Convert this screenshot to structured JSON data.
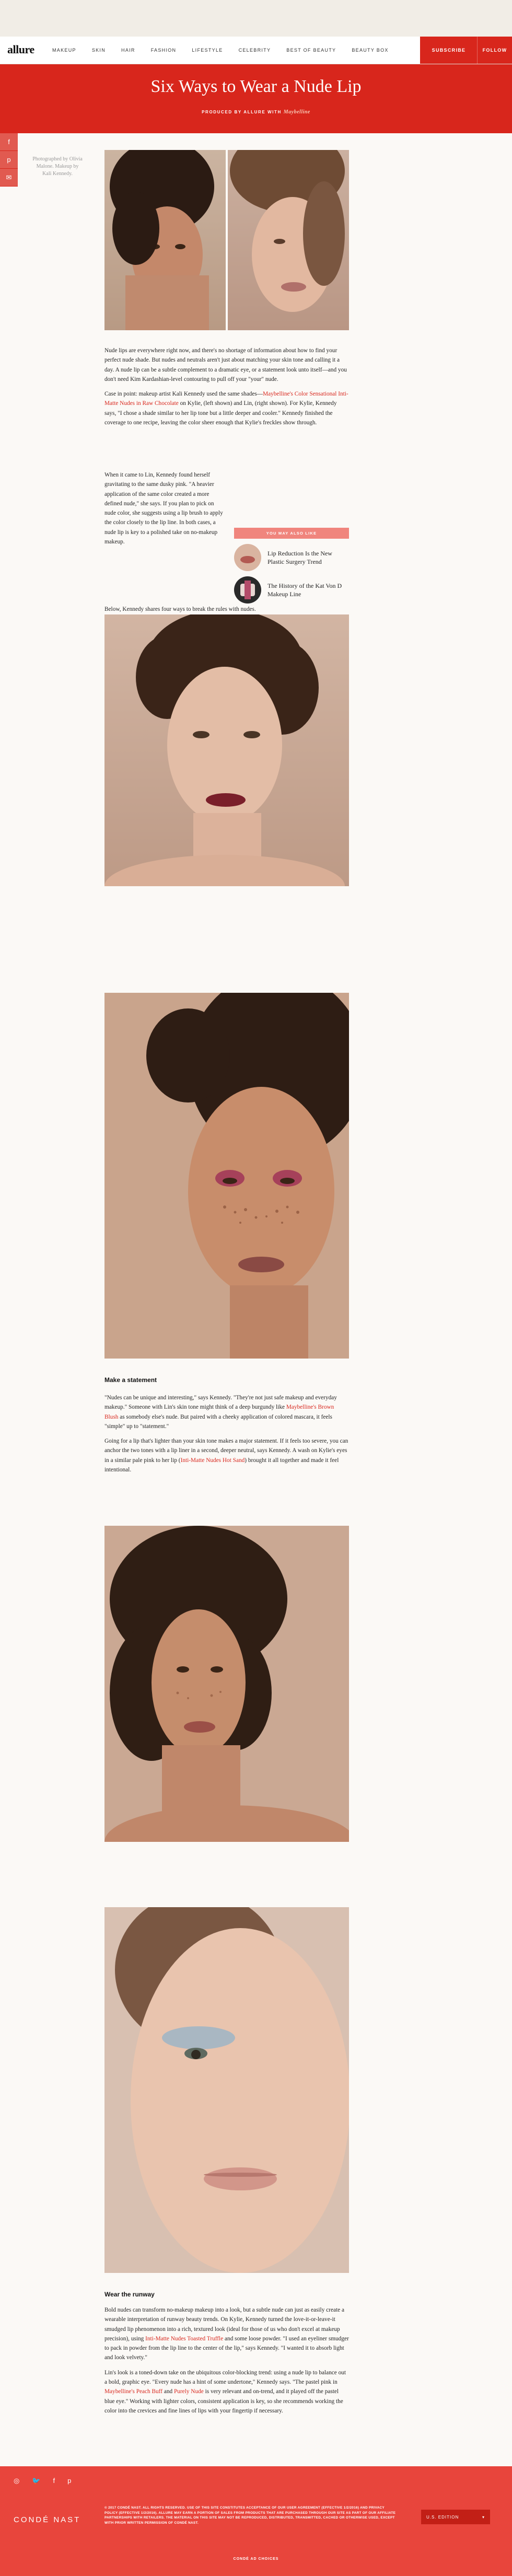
{
  "site": {
    "logo": "allure",
    "nav": [
      "MAKEUP",
      "SKIN",
      "HAIR",
      "FASHION",
      "LIFESTYLE",
      "CELEBRITY",
      "BEST OF BEAUTY",
      "BEAUTY BOX"
    ],
    "subscribe": "SUBSCRIBE",
    "follow": "FOLLOW"
  },
  "article": {
    "title": "Six Ways to Wear a Nude Lip",
    "credit_prefix": "PRODUCED BY ALLURE WITH",
    "credit_brand": "Maybelline",
    "photo_caption": "Photographed by Olivia Malone. Makeup by Kali Kennedy.",
    "share": [
      "f",
      "p",
      "✉"
    ],
    "intro_1": "Nude lips are everywhere right now, and there's no shortage of information about how to find your perfect nude shade. But nudes and neutrals aren't just about matching your skin tone and calling it a day. A nude lip can be a subtle complement to a dramatic eye, or a statement look unto itself—and you don't need Kim Kardashian-level contouring to pull off your \"your\" nude.",
    "intro_2_a": "Case in point: makeup artist Kali Kennedy used the same shades—",
    "intro_2_link": "Maybelline's Color Sensational Inti-Matte Nudes in Raw Chocolate",
    "intro_2_b": " on Kylie, (left shown) and Lin, (right shown). For Kylie, Kennedy says, \"I chose a shade similar to her lip tone but a little deeper and cooler.\" Kennedy finished the coverage to one recipe, leaving the color sheer enough that Kylie's freckles show through.",
    "intro_3": "When it came to Lin, Kennedy found herself gravitating to the same dusky pink. \"A heavier application of the same color created a more defined nude,\" she says. If you plan to pick on nude color, she suggests using a lip brush to apply the color closely to the lip line. In both cases, a nude lip is key to a polished take on no-makeup makeup.",
    "intro_4": "Below, Kennedy shares four ways to break the rules with nudes.",
    "read_also": {
      "header": "YOU MAY ALSO LIKE",
      "items": [
        "Lip Reduction Is the New Plastic Surgery Trend",
        "The History of the Kat Von D Makeup Line"
      ]
    },
    "section_1": {
      "title": "Make a statement",
      "p1_a": "\"Nudes can be unique and interesting,\" says Kennedy. \"They're not just safe makeup and everyday makeup.\" Someone with Lin's skin tone might think of a deep burgundy like ",
      "p1_link": "Maybelline's Brown Blush",
      "p1_b": " as somebody else's nude. But paired with a cheeky application of colored mascara, it feels \"simple\" up to \"statement.\"",
      "p2_a": "Going for a lip that's lighter than your skin tone makes a major statement. If it feels too severe, you can anchor the two tones with a lip liner in a second, deeper neutral, says Kennedy. A wash on Kylie's eyes in a similar pale pink to her lip (",
      "p2_link": "Inti-Matte Nudes Hot Sand",
      "p2_b": ") brought it all together and made it feel intentional."
    },
    "section_2": {
      "title": "Wear the runway",
      "p1_a": "Bold nudes can transform no-makeup makeup into a look, but a subtle nude can just as easily create a wearable interpretation of runway beauty trends. On Kylie, Kennedy turned the love-it-or-leave-it smudged lip phenomenon into a rich, textured look (ideal for those of us who don't excel at makeup precision), using ",
      "p1_link": "Inti-Matte Nudes Toasted Truffle",
      "p1_b": " and some loose powder. \"I used an eyeliner smudger to pack in powder from the lip line to the center of the lip,\" says Kennedy. \"I wanted it to absorb light and look velvety.\"",
      "p2_a": "Lin's look is a toned-down take on the ubiquitous color-blocking trend: using a nude lip to balance out a bold, graphic eye. \"Every nude has a hint of some undertone,\" Kennedy says. \"The pastel pink in ",
      "p2_link1": "Maybelline's Peach Buff",
      "p2_mid": " and ",
      "p2_link2": "Purely Nude",
      "p2_b": " is very relevant and on-trend, and it played off the pastel blue eye.\" Working with lighter colors, consistent application is key, so she recommends working the color into the crevices and fine lines of lips with your fingertip if necessary."
    }
  },
  "footer": {
    "icons": [
      "◎",
      "🐦",
      "f",
      "p"
    ],
    "brand": "CONDÉ NAST",
    "legal": "© 2017 CONDÉ NAST. ALL RIGHTS RESERVED. USE OF THIS SITE CONSTITUTES ACCEPTANCE OF OUR USER AGREEMENT (EFFECTIVE 1/2/2016) AND PRIVACY POLICY (EFFECTIVE 1/2/2016). ALLURE MAY EARN A PORTION OF SALES FROM PRODUCTS THAT ARE PURCHASED THROUGH OUR SITE AS PART OF OUR AFFILIATE PARTNERSHIPS WITH RETAILERS. THE MATERIAL ON THIS SITE MAY NOT BE REPRODUCED, DISTRIBUTED, TRANSMITTED, CACHED OR OTHERWISE USED, EXCEPT WITH PRIOR WRITTEN PERMISSION OF CONDÉ NAST.",
    "region": "U.S. EDITION",
    "ad_choices": "CONDÉ AD CHOICES"
  },
  "colors": {
    "brand_red": "#d8261c",
    "coral": "#e8453c",
    "link": "#d8261c"
  }
}
